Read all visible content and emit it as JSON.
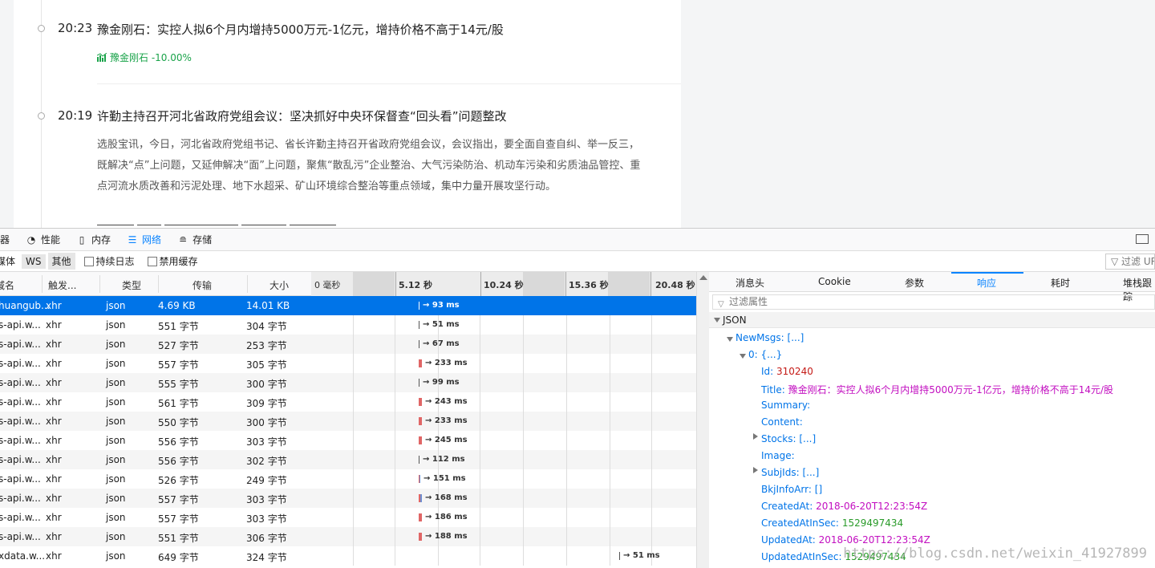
{
  "news": {
    "items": [
      {
        "time": "20:23",
        "title": "豫金刚石：实控人拟6个月内增持5000万元-1亿元，增持价格不高于14元/股",
        "stock_tag": "豫金刚石 -10.00%"
      },
      {
        "time": "20:19",
        "title": "许勤主持召开河北省政府党组会议：坚决抓好中央环保督查“回头看”问题整改",
        "summary": "选股宝讯，今日，河北省政府党组书记、省长许勤主持召开省政府党组会议，会议指出，要全面自查自纠、举一反三，既解决“点”上问题，又延伸解决“面”上问题，聚焦“散乱污”企业整治、大气污染防治、机动车污染和劣质油品管控、重点河流水质改善和污泥处理、地下水超采、矿山环境综合整治等重点领域，集中力量开展攻坚行动。"
      }
    ]
  },
  "devtools": {
    "tabs": [
      {
        "label": "器",
        "icon": ""
      },
      {
        "label": "性能",
        "icon": "performance-icon"
      },
      {
        "label": "内存",
        "icon": "memory-icon"
      },
      {
        "label": "网络",
        "icon": "network-icon"
      },
      {
        "label": "存储",
        "icon": "storage-icon"
      }
    ],
    "filter_buttons": [
      "媒体",
      "WS",
      "其他"
    ],
    "persist_logs": "持续日志",
    "disable_cache": "禁用缓存",
    "url_filter": "过滤 URL",
    "columns": [
      "域名",
      "触发...",
      "类型",
      "传输",
      "大小",
      "0 毫秒",
      "5.12 秒",
      "10.24 秒",
      "15.36 秒",
      "20.48 秒"
    ],
    "requests": [
      {
        "file": "huangub...",
        "cause": "xhr",
        "type": "json",
        "transferred": "4.69 KB",
        "size": "14.01 KB",
        "duration": "→ 93 ms"
      },
      {
        "file": "s-api.w...",
        "cause": "xhr",
        "type": "json",
        "transferred": "551 字节",
        "size": "304 字节",
        "duration": "→ 51 ms"
      },
      {
        "file": "s-api.w...",
        "cause": "xhr",
        "type": "json",
        "transferred": "527 字节",
        "size": "253 字节",
        "duration": "→ 67 ms"
      },
      {
        "file": "s-api.w...",
        "cause": "xhr",
        "type": "json",
        "transferred": "557 字节",
        "size": "305 字节",
        "duration": "→ 233 ms"
      },
      {
        "file": "s-api.w...",
        "cause": "xhr",
        "type": "json",
        "transferred": "555 字节",
        "size": "300 字节",
        "duration": "→ 99 ms"
      },
      {
        "file": "s-api.w...",
        "cause": "xhr",
        "type": "json",
        "transferred": "561 字节",
        "size": "309 字节",
        "duration": "→ 243 ms"
      },
      {
        "file": "s-api.w...",
        "cause": "xhr",
        "type": "json",
        "transferred": "550 字节",
        "size": "300 字节",
        "duration": "→ 233 ms"
      },
      {
        "file": "s-api.w...",
        "cause": "xhr",
        "type": "json",
        "transferred": "556 字节",
        "size": "303 字节",
        "duration": "→ 245 ms"
      },
      {
        "file": "s-api.w...",
        "cause": "xhr",
        "type": "json",
        "transferred": "556 字节",
        "size": "302 字节",
        "duration": "→ 112 ms"
      },
      {
        "file": "s-api.w...",
        "cause": "xhr",
        "type": "json",
        "transferred": "526 字节",
        "size": "249 字节",
        "duration": "→ 151 ms"
      },
      {
        "file": "s-api.w...",
        "cause": "xhr",
        "type": "json",
        "transferred": "557 字节",
        "size": "303 字节",
        "duration": "→ 168 ms"
      },
      {
        "file": "s-api.w...",
        "cause": "xhr",
        "type": "json",
        "transferred": "557 字节",
        "size": "303 字节",
        "duration": "→ 186 ms"
      },
      {
        "file": "s-api.w...",
        "cause": "xhr",
        "type": "json",
        "transferred": "551 字节",
        "size": "306 字节",
        "duration": "→ 188 ms"
      },
      {
        "file": "xdata.w...",
        "cause": "xhr",
        "type": "json",
        "transferred": "649 字节",
        "size": "324 字节",
        "duration": "→ 51 ms"
      }
    ],
    "detail_tabs": [
      "消息头",
      "Cookie",
      "参数",
      "响应",
      "耗时",
      "堆栈跟踪"
    ],
    "prop_filter_placeholder": "过滤属性",
    "json_label": "JSON",
    "json": {
      "newmsgs_key": "NewMsgs:",
      "newmsgs_val": "[...]",
      "item0_key": "0:",
      "item0_val": "{...}",
      "id_key": "Id:",
      "id_val": "310240",
      "title_key": "Title:",
      "title_val": "豫金刚石：实控人拟6个月内增持5000万元-1亿元，增持价格不高于14元/股",
      "summary_key": "Summary:",
      "content_key": "Content:",
      "stocks_key": "Stocks:",
      "stocks_val": "[...]",
      "image_key": "Image:",
      "subjids_key": "SubjIds:",
      "subjids_val": "[...]",
      "bkj_key": "BkjInfoArr:",
      "bkj_val": "[]",
      "created_key": "CreatedAt:",
      "created_val": "2018-06-20T12:23:54Z",
      "created_sec_key": "CreatedAtInSec:",
      "created_sec_val": "1529497434",
      "updated_key": "UpdatedAt:",
      "updated_val": "2018-06-20T12:23:54Z",
      "updated_sec_key": "UpdatedAtInSec:",
      "updated_sec_val": "1529497434"
    }
  },
  "watermark": "https://blog.csdn.net/weixin_41927899"
}
